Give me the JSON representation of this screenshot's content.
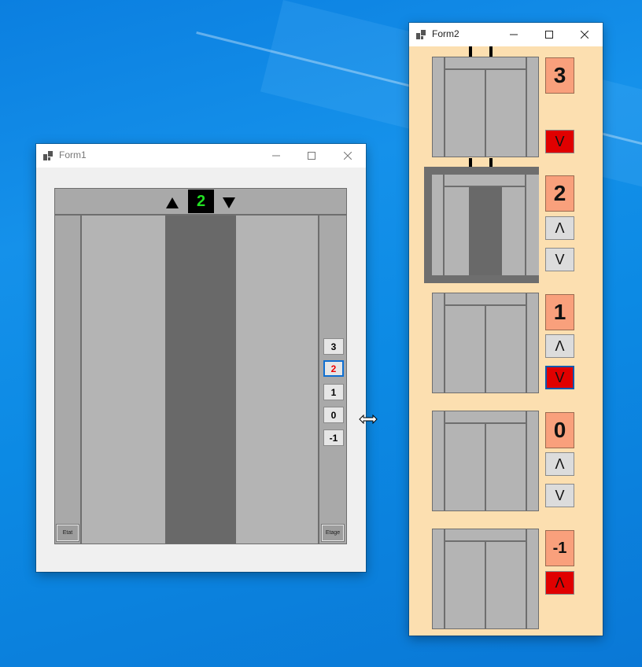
{
  "form1": {
    "title": "Form1",
    "floor_display": "2",
    "floor_buttons": [
      "3",
      "2",
      "1",
      "0",
      "-1"
    ],
    "selected_floor": "2",
    "etat_label": "Etat",
    "etage_label": "Etage",
    "display_color": "#22e022"
  },
  "form2": {
    "title": "Form2",
    "floors": [
      {
        "label": "3",
        "buttons": [
          "V"
        ]
      },
      {
        "label": "2",
        "buttons": [
          "Λ",
          "V"
        ]
      },
      {
        "label": "1",
        "buttons": [
          "Λ",
          "V"
        ]
      },
      {
        "label": "0",
        "buttons": [
          "Λ",
          "V"
        ]
      },
      {
        "label": "-1",
        "buttons": [
          "Λ"
        ]
      }
    ],
    "active_call_color": "#e00000"
  },
  "titlebar_icons": [
    "minimize-icon",
    "maximize-icon",
    "close-icon"
  ]
}
